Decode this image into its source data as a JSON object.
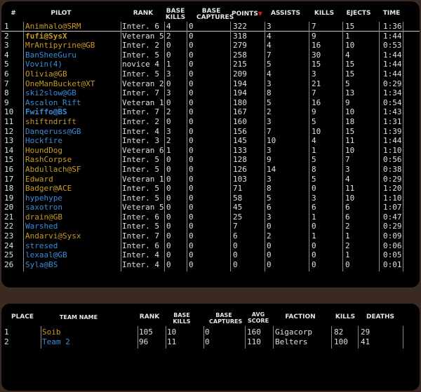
{
  "pilot_table": {
    "headers": {
      "num": "#",
      "pilot": "PILOT",
      "rank": "RANK",
      "base_kills": "BASE KILLS",
      "base_captures": "BASE CAPTURES",
      "points": "POINTS",
      "sort_arrow": "▼",
      "assists": "ASSISTS",
      "kills": "KILLS",
      "ejects": "EJECTS",
      "time": "TIME"
    },
    "rows": [
      {
        "num": "1",
        "pilot": "Animhalo@SRM",
        "rank": "Inter. 6",
        "bk": "4",
        "bc": "0",
        "points": "322",
        "assists": "3",
        "kills": "7",
        "ejects": "15",
        "time": "1:36",
        "color": "gold",
        "bold": false
      },
      {
        "num": "2",
        "pilot": "fufi@SysX",
        "rank": "Veteran 5",
        "bk": "2",
        "bc": "0",
        "points": "318",
        "assists": "4",
        "kills": "9",
        "ejects": "1",
        "time": "1:44",
        "color": "gold",
        "bold": true
      },
      {
        "num": "3",
        "pilot": "MrAntipyrine@GB",
        "rank": "Inter. 2",
        "bk": "0",
        "bc": "0",
        "points": "279",
        "assists": "4",
        "kills": "16",
        "ejects": "10",
        "time": "0:53",
        "color": "gold",
        "bold": false
      },
      {
        "num": "4",
        "pilot": "BanSheeGuru",
        "rank": "Inter. 5",
        "bk": "0",
        "bc": "0",
        "points": "258",
        "assists": "7",
        "kills": "30",
        "ejects": "4",
        "time": "1:44",
        "color": "blue",
        "bold": false
      },
      {
        "num": "5",
        "pilot": "Vovin(4)",
        "rank": "novice 4",
        "bk": "1",
        "bc": "0",
        "points": "215",
        "assists": "5",
        "kills": "15",
        "ejects": "15",
        "time": "1:44",
        "color": "blue",
        "bold": false
      },
      {
        "num": "6",
        "pilot": "Olivia@GB",
        "rank": "Inter. 5",
        "bk": "3",
        "bc": "0",
        "points": "209",
        "assists": "4",
        "kills": "3",
        "ejects": "15",
        "time": "1:44",
        "color": "gold",
        "bold": false
      },
      {
        "num": "7",
        "pilot": "OneManBucket@XT",
        "rank": "Veteran 2",
        "bk": "0",
        "bc": "0",
        "points": "194",
        "assists": "3",
        "kills": "21",
        "ejects": "5",
        "time": "0:29",
        "color": "gold",
        "bold": false
      },
      {
        "num": "8",
        "pilot": "ski2slow@GB",
        "rank": "Inter. 7",
        "bk": "3",
        "bc": "0",
        "points": "194",
        "assists": "8",
        "kills": "7",
        "ejects": "13",
        "time": "1:34",
        "color": "blue",
        "bold": false
      },
      {
        "num": "9",
        "pilot": "Ascalon_Rift",
        "rank": "Veteran 1",
        "bk": "0",
        "bc": "0",
        "points": "180",
        "assists": "5",
        "kills": "16",
        "ejects": "9",
        "time": "0:54",
        "color": "blue",
        "bold": false
      },
      {
        "num": "10",
        "pilot": "Fwiffo@BS",
        "rank": "Inter. 7",
        "bk": "2",
        "bc": "0",
        "points": "167",
        "assists": "2",
        "kills": "9",
        "ejects": "10",
        "time": "1:43",
        "color": "blue",
        "bold": true
      },
      {
        "num": "11",
        "pilot": "shiftndrift",
        "rank": "Inter. 2",
        "bk": "0",
        "bc": "0",
        "points": "160",
        "assists": "3",
        "kills": "5",
        "ejects": "18",
        "time": "1:31",
        "color": "gold",
        "bold": false
      },
      {
        "num": "12",
        "pilot": "Danqeruss@GB",
        "rank": "Inter. 4",
        "bk": "3",
        "bc": "0",
        "points": "156",
        "assists": "7",
        "kills": "10",
        "ejects": "15",
        "time": "1:39",
        "color": "blue",
        "bold": false
      },
      {
        "num": "13",
        "pilot": "Hockfire",
        "rank": "Inter. 3",
        "bk": "2",
        "bc": "0",
        "points": "145",
        "assists": "10",
        "kills": "4",
        "ejects": "11",
        "time": "1:44",
        "color": "blue",
        "bold": false
      },
      {
        "num": "14",
        "pilot": "HoundDog",
        "rank": "Veteran 6",
        "bk": "1",
        "bc": "0",
        "points": "133",
        "assists": "3",
        "kills": "1",
        "ejects": "10",
        "time": "1:10",
        "color": "gold",
        "bold": false
      },
      {
        "num": "15",
        "pilot": "RashCorpse",
        "rank": "Inter. 5",
        "bk": "0",
        "bc": "0",
        "points": "128",
        "assists": "9",
        "kills": "5",
        "ejects": "7",
        "time": "0:56",
        "color": "gold",
        "bold": false
      },
      {
        "num": "16",
        "pilot": "Abdullach@SF",
        "rank": "Inter. 5",
        "bk": "0",
        "bc": "0",
        "points": "126",
        "assists": "14",
        "kills": "8",
        "ejects": "3",
        "time": "0:38",
        "color": "gold",
        "bold": false
      },
      {
        "num": "17",
        "pilot": "Edward",
        "rank": "Veteran 1",
        "bk": "0",
        "bc": "0",
        "points": "103",
        "assists": "3",
        "kills": "5",
        "ejects": "4",
        "time": "0:29",
        "color": "gold",
        "bold": false
      },
      {
        "num": "18",
        "pilot": "Badger@ACE",
        "rank": "Inter. 5",
        "bk": "0",
        "bc": "0",
        "points": "71",
        "assists": "8",
        "kills": "0",
        "ejects": "11",
        "time": "1:20",
        "color": "gold",
        "bold": false
      },
      {
        "num": "19",
        "pilot": "hypehype",
        "rank": "Inter. 5",
        "bk": "0",
        "bc": "0",
        "points": "58",
        "assists": "5",
        "kills": "3",
        "ejects": "10",
        "time": "1:10",
        "color": "blue",
        "bold": false
      },
      {
        "num": "20",
        "pilot": "saxotron",
        "rank": "Veteran 5",
        "bk": "0",
        "bc": "0",
        "points": "45",
        "assists": "6",
        "kills": "6",
        "ejects": "6",
        "time": "1:07",
        "color": "blue",
        "bold": false
      },
      {
        "num": "21",
        "pilot": "drain@GB",
        "rank": "Inter. 6",
        "bk": "0",
        "bc": "0",
        "points": "25",
        "assists": "3",
        "kills": "1",
        "ejects": "6",
        "time": "0:47",
        "color": "gold",
        "bold": false
      },
      {
        "num": "22",
        "pilot": "Warshed",
        "rank": "Inter. 5",
        "bk": "0",
        "bc": "0",
        "points": "7",
        "assists": "0",
        "kills": "0",
        "ejects": "2",
        "time": "0:29",
        "color": "blue",
        "bold": false
      },
      {
        "num": "23",
        "pilot": "Andarvi@Sysx",
        "rank": "Inter. 7",
        "bk": "0",
        "bc": "0",
        "points": "6",
        "assists": "2",
        "kills": "1",
        "ejects": "1",
        "time": "0:09",
        "color": "gold",
        "bold": false
      },
      {
        "num": "24",
        "pilot": "stresed",
        "rank": "Inter. 6",
        "bk": "0",
        "bc": "0",
        "points": "0",
        "assists": "0",
        "kills": "0",
        "ejects": "2",
        "time": "0:06",
        "color": "blue",
        "bold": false
      },
      {
        "num": "25",
        "pilot": "lexaal@GB",
        "rank": "Inter. 4",
        "bk": "0",
        "bc": "0",
        "points": "0",
        "assists": "0",
        "kills": "0",
        "ejects": "1",
        "time": "0:05",
        "color": "blue",
        "bold": false
      },
      {
        "num": "26",
        "pilot": "Syla@BS",
        "rank": "Inter. 4",
        "bk": "0",
        "bc": "0",
        "points": "0",
        "assists": "0",
        "kills": "0",
        "ejects": "0",
        "time": "0:01",
        "color": "blue",
        "bold": false
      }
    ]
  },
  "team_table": {
    "headers": {
      "place": "PLACE",
      "team_name": "TEAM NAME",
      "rank": "RANK",
      "base_kills": "BASE KILLS",
      "base_captures": "BASE CAPTURES",
      "avg_score": "AVG SCORE",
      "faction": "FACTION",
      "kills": "KILLS",
      "deaths": "DEATHS"
    },
    "rows": [
      {
        "place": "1",
        "team": "Soib",
        "rank": "105",
        "bk": "10",
        "bc": "0",
        "avg": "160",
        "faction": "Gigacorp",
        "kills": "82",
        "deaths": "29",
        "color": "gold"
      },
      {
        "place": "2",
        "team": "Team 2",
        "rank": "96",
        "bk": "11",
        "bc": "0",
        "avg": "110",
        "faction": "Belters",
        "kills": "100",
        "deaths": "41",
        "color": "blue"
      }
    ]
  },
  "colors": {
    "gold": "#c89a20",
    "blue": "#3a8ad8",
    "text": "#e0e0e0",
    "background": "#000000",
    "frame": "#3a2a22"
  }
}
